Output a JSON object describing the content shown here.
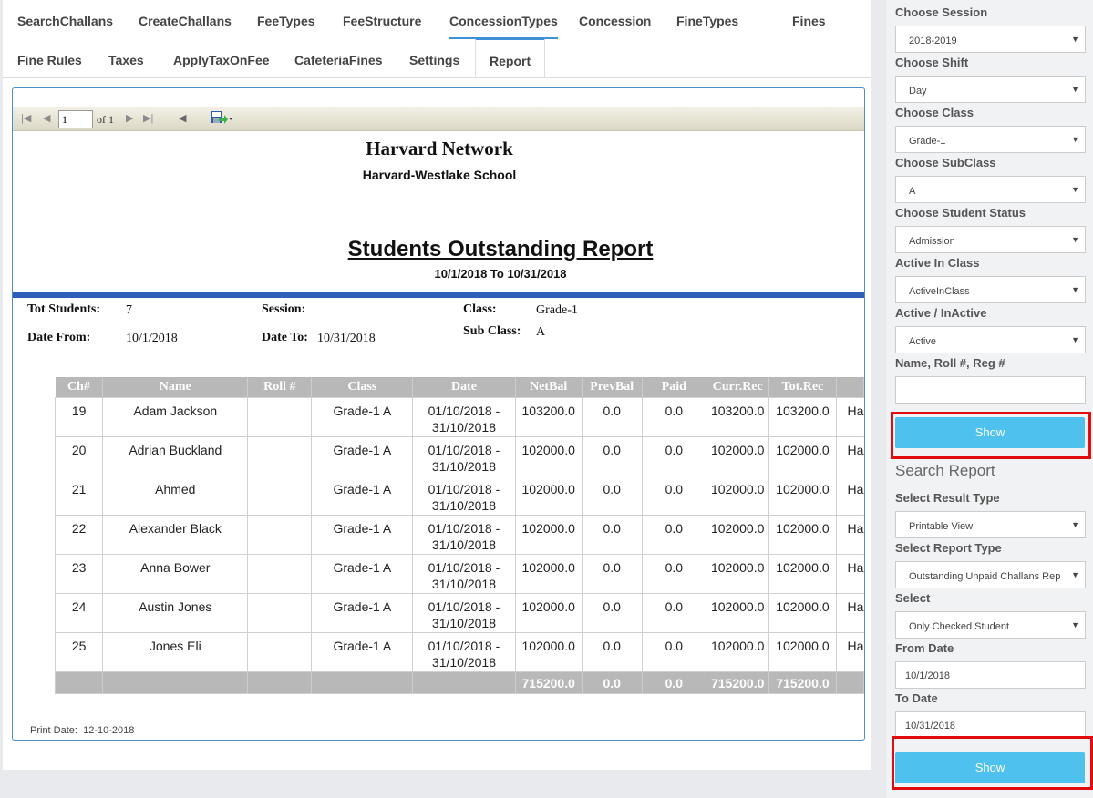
{
  "tabs": {
    "row1": [
      "SearchChallans",
      "CreateChallans",
      "FeeTypes",
      "FeeStructure",
      "ConcessionTypes",
      "Concession",
      "FineTypes",
      "Fines"
    ],
    "row2": [
      "Fine Rules",
      "Taxes",
      "ApplyTaxOnFee",
      "CafeteriaFines",
      "Settings",
      "Report"
    ],
    "active": "Report"
  },
  "toolbar": {
    "page_value": "1",
    "of_text": "of 1"
  },
  "report": {
    "org": "Harvard Network",
    "school": "Harvard-Westlake School",
    "title": "Students Outstanding Report",
    "range": "10/1/2018 To 10/31/2018",
    "info": {
      "tot_students_label": "Tot Students:",
      "tot_students": "7",
      "session_label": "Session:",
      "class_label": "Class:",
      "class": "Grade-1",
      "date_from_label": "Date From:",
      "date_from": "10/1/2018",
      "date_to_label": "Date To:",
      "date_to": "10/31/2018",
      "subclass_label": "Sub Class:",
      "subclass": "A"
    },
    "columns": [
      "Ch#",
      "Name",
      "Roll #",
      "Class",
      "Date",
      "NetBal",
      "PrevBal",
      "Paid",
      "Curr.Rec",
      "Tot.Rec",
      ""
    ],
    "rows": [
      {
        "ch": "19",
        "name": "Adam Jackson",
        "roll": "",
        "class": "Grade-1 A",
        "date": "01/10/2018 - 31/10/2018",
        "netbal": "103200.0",
        "prevbal": "0.0",
        "paid": "0.0",
        "currrec": "103200.0",
        "totrec": "103200.0",
        "extra": "Ha"
      },
      {
        "ch": "20",
        "name": "Adrian Buckland",
        "roll": "",
        "class": "Grade-1 A",
        "date": "01/10/2018 - 31/10/2018",
        "netbal": "102000.0",
        "prevbal": "0.0",
        "paid": "0.0",
        "currrec": "102000.0",
        "totrec": "102000.0",
        "extra": "Ha"
      },
      {
        "ch": "21",
        "name": "Ahmed",
        "roll": "",
        "class": "Grade-1 A",
        "date": "01/10/2018 - 31/10/2018",
        "netbal": "102000.0",
        "prevbal": "0.0",
        "paid": "0.0",
        "currrec": "102000.0",
        "totrec": "102000.0",
        "extra": "Ha"
      },
      {
        "ch": "22",
        "name": "Alexander Black",
        "roll": "",
        "class": "Grade-1 A",
        "date": "01/10/2018 - 31/10/2018",
        "netbal": "102000.0",
        "prevbal": "0.0",
        "paid": "0.0",
        "currrec": "102000.0",
        "totrec": "102000.0",
        "extra": "Ha"
      },
      {
        "ch": "23",
        "name": "Anna Bower",
        "roll": "",
        "class": "Grade-1 A",
        "date": "01/10/2018 - 31/10/2018",
        "netbal": "102000.0",
        "prevbal": "0.0",
        "paid": "0.0",
        "currrec": "102000.0",
        "totrec": "102000.0",
        "extra": "Ha"
      },
      {
        "ch": "24",
        "name": "Austin Jones",
        "roll": "",
        "class": "Grade-1 A",
        "date": "01/10/2018 - 31/10/2018",
        "netbal": "102000.0",
        "prevbal": "0.0",
        "paid": "0.0",
        "currrec": "102000.0",
        "totrec": "102000.0",
        "extra": "Ha"
      },
      {
        "ch": "25",
        "name": "Jones Eli",
        "roll": "",
        "class": "Grade-1 A",
        "date": "01/10/2018 - 31/10/2018",
        "netbal": "102000.0",
        "prevbal": "0.0",
        "paid": "0.0",
        "currrec": "102000.0",
        "totrec": "102000.0",
        "extra": "Ha"
      }
    ],
    "totals": {
      "netbal": "715200.0",
      "prevbal": "0.0",
      "paid": "0.0",
      "currrec": "715200.0",
      "totrec": "715200.0"
    },
    "print_date_label": "Print Date:",
    "print_date": "12-10-2018"
  },
  "sidebar": {
    "session_label": "Choose Session",
    "session": "2018-2019",
    "shift_label": "Choose Shift",
    "shift": "Day",
    "class_label": "Choose Class",
    "class": "Grade-1",
    "subclass_label": "Choose SubClass",
    "subclass": "A",
    "status_label": "Choose Student Status",
    "status": "Admission",
    "active_class_label": "Active In Class",
    "active_class": "ActiveInClass",
    "active_label": "Active / InActive",
    "active": "Active",
    "search_label": "Name, Roll #, Reg #",
    "search_value": "",
    "show_button": "Show",
    "search_report_heading": "Search Report",
    "result_type_label": "Select Result Type",
    "result_type": "Printable View",
    "report_type_label": "Select Report Type",
    "report_type": "Outstanding Unpaid Challans Rep",
    "select_label": "Select",
    "select": "Only Checked Student",
    "from_date_label": "From Date",
    "from_date": "10/1/2018",
    "to_date_label": "To Date",
    "to_date": "10/31/2018",
    "show_button_2": "Show"
  },
  "colors": {
    "accent_blue": "#2c5fb8",
    "button": "#4fc1ee",
    "highlight_red": "#e10d0d",
    "grid_header": "#b8b8b8"
  }
}
